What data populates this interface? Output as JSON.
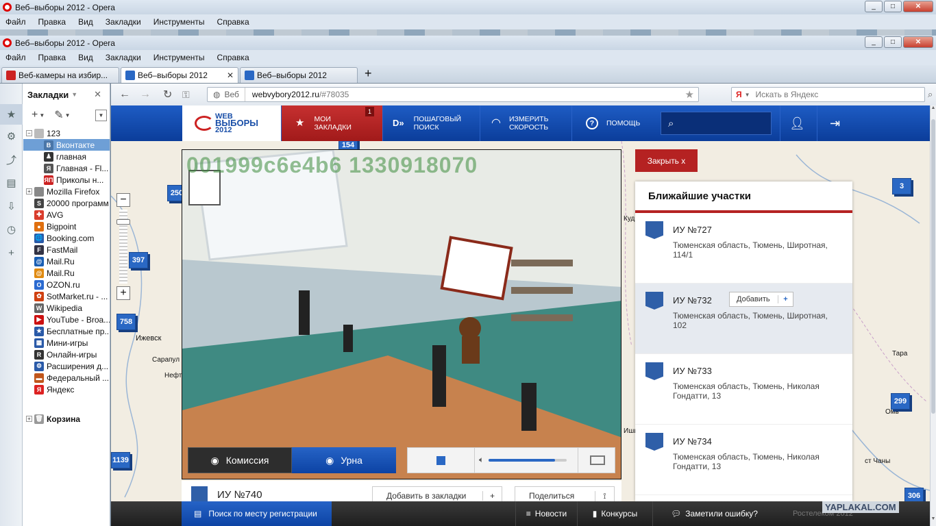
{
  "outer_window": {
    "title": "Веб–выборы 2012 - Opera",
    "menu": [
      "Файл",
      "Правка",
      "Вид",
      "Закладки",
      "Инструменты",
      "Справка"
    ]
  },
  "window": {
    "title": "Веб–выборы 2012 - Opera",
    "menu": [
      "Файл",
      "Правка",
      "Вид",
      "Закладки",
      "Инструменты",
      "Справка"
    ]
  },
  "tabs": [
    {
      "label": "Веб-камеры на избир...",
      "favicon_color": "#cc2222"
    },
    {
      "label": "Веб–выборы 2012",
      "favicon_color": "#2a68c4"
    },
    {
      "label": "Веб–выборы 2012",
      "favicon_color": "#2a68c4"
    }
  ],
  "address": {
    "scope": "Веб",
    "url_host": "webvybory2012.ru",
    "url_path": "/#78035",
    "search_placeholder": "Искать в Яндекс"
  },
  "bookmarks": {
    "title": "Закладки",
    "folder": "123",
    "items_in_folder": [
      {
        "label": "Вконтакте",
        "color": "#4a76a8",
        "glyph": "B"
      },
      {
        "label": "главная",
        "color": "#333333",
        "glyph": "♟"
      },
      {
        "label": "Главная - Fl...",
        "color": "#555555",
        "glyph": "Я"
      },
      {
        "label": "Приколы н...",
        "color": "#cc2222",
        "glyph": "ЯП"
      }
    ],
    "items": [
      {
        "label": "Mozilla Firefox",
        "color": "#888888",
        "glyph": "",
        "folder": true
      },
      {
        "label": "20000 программ",
        "color": "#444444",
        "glyph": "S"
      },
      {
        "label": "AVG",
        "color": "#d93c2c",
        "glyph": "✚"
      },
      {
        "label": "Bigpoint",
        "color": "#e07010",
        "glyph": "●"
      },
      {
        "label": "Booking.com",
        "color": "#2a5aa8",
        "glyph": "🌐"
      },
      {
        "label": "FastMail",
        "color": "#334",
        "glyph": "F"
      },
      {
        "label": "Mail.Ru",
        "color": "#1a5fb4",
        "glyph": "@"
      },
      {
        "label": "Mail.Ru",
        "color": "#e08a10",
        "glyph": "@"
      },
      {
        "label": "OZON.ru",
        "color": "#2a6ad0",
        "glyph": "O"
      },
      {
        "label": "SotMarket.ru - ...",
        "color": "#d04010",
        "glyph": "✿"
      },
      {
        "label": "Wikipedia",
        "color": "#666666",
        "glyph": "W"
      },
      {
        "label": "YouTube - Broa...",
        "color": "#cc1111",
        "glyph": "▶"
      },
      {
        "label": "Бесплатные пр...",
        "color": "#2a5aa8",
        "glyph": "★"
      },
      {
        "label": "Мини-игры",
        "color": "#2a5aa8",
        "glyph": "▦"
      },
      {
        "label": "Онлайн-игры",
        "color": "#333333",
        "glyph": "R"
      },
      {
        "label": "Расширения д...",
        "color": "#2a5aa8",
        "glyph": "⚙"
      },
      {
        "label": "Федеральный ...",
        "color": "#c0551a",
        "glyph": "▬"
      },
      {
        "label": "Яндекс",
        "color": "#dd2222",
        "glyph": "Я"
      }
    ],
    "trash": "Корзина"
  },
  "site": {
    "logo_line1": "WEB",
    "logo_line2": "ВЫБОРЫ",
    "logo_line3": "2012",
    "nav": [
      {
        "line1": "МОИ",
        "line2": "ЗАКЛАДКИ",
        "badge": "1",
        "icon": "star-icon"
      },
      {
        "line1": "ПОШАГОВЫЙ",
        "line2": "ПОИСК",
        "icon": "steps-icon"
      },
      {
        "line1": "ИЗМЕРИТЬ",
        "line2": "СКОРОСТЬ",
        "icon": "speedometer-icon"
      },
      {
        "line1": "ПОМОЩЬ",
        "line2": "",
        "icon": "help-icon"
      }
    ],
    "close_label": "Закрыть x"
  },
  "map_badges": [
    "154",
    "250",
    "397",
    "758",
    "1139",
    "3",
    "299",
    "306"
  ],
  "map_places": [
    "Ижевск",
    "Сарапул",
    "Нефт",
    "Кудымкар",
    "Тара",
    "Омь",
    "ст Чаны",
    "Ишим"
  ],
  "video": {
    "overlay_text": "001999c6e4b6 1330918070",
    "btn_commission": "Комиссия",
    "btn_urna": "Урна",
    "volume": 0.85
  },
  "current_plot": {
    "name": "ИУ №740",
    "add_bookmark": "Добавить в закладки",
    "share": "Поделиться"
  },
  "nearest": {
    "title": "Ближайшие участки",
    "add_label": "Добавить",
    "items": [
      {
        "name": "ИУ №727",
        "address": "Тюменская область, Тюмень, Широтная, 114/1"
      },
      {
        "name": "ИУ №732",
        "address": "Тюменская область, Тюмень, Широтная, 102"
      },
      {
        "name": "ИУ №733",
        "address": "Тюменская область, Тюмень, Николая Гондатти, 13"
      },
      {
        "name": "ИУ №734",
        "address": "Тюменская область, Тюмень, Николая Гондатти, 13"
      }
    ]
  },
  "footer": {
    "search_reg": "Поиск по месту регистрации",
    "news": "Новости",
    "contests": "Конкурсы",
    "report": "Заметили ошибку?",
    "copyright": "Ростелеком 2012",
    "watermark": "YAPLAKAL.COM"
  },
  "colors": {
    "nav_blue": "#0b3d9a",
    "accent_red": "#b52222",
    "map_bg": "#f2ede2"
  }
}
